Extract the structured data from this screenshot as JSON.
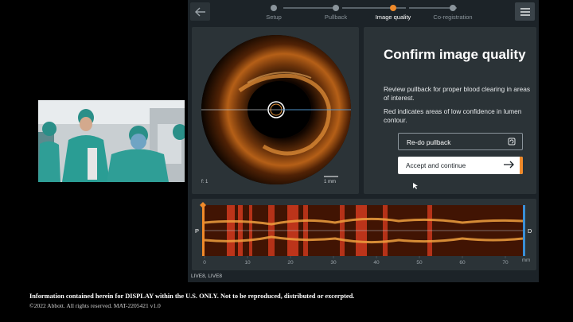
{
  "stepper": {
    "steps": [
      {
        "label": "Setup",
        "active": false
      },
      {
        "label": "Pullback",
        "active": false
      },
      {
        "label": "Image quality",
        "active": true
      },
      {
        "label": "Co-registration",
        "active": false
      }
    ]
  },
  "oct_view": {
    "frame_label": "f: 1",
    "scale_label": "1 mm"
  },
  "info": {
    "title": "Confirm image quality",
    "text1": "Review pullback for proper blood clearing in areas of interest.",
    "text2": "Red indicates areas of low confidence in lumen contour.",
    "redo_label": "Re-do pullback",
    "accept_label": "Accept and continue"
  },
  "longitudinal": {
    "left_marker": "P",
    "right_marker": "D",
    "ticks": [
      "0",
      "10",
      "20",
      "30",
      "40",
      "50",
      "60",
      "70"
    ],
    "unit": "mm"
  },
  "bottom_label": "LIVE8, LIVE8",
  "footer": {
    "line1": "Information contained herein for DISPLAY within the U.S. ONLY. Not to be reproduced, distributed or excerpted.",
    "line2": "©2022 Abbott. All rights reserved. MAT-2205421 v1.0"
  },
  "colors": {
    "accent": "#f08a2a",
    "panel": "#2b3337",
    "app_bg": "#1c2328",
    "low_confidence": "#d23a1e",
    "p_marker": "#f08a2a",
    "d_marker": "#3a8fd6"
  },
  "icons": [
    "back-arrow-icon",
    "hamburger-menu-icon",
    "redo-icon",
    "arrow-right-icon"
  ]
}
